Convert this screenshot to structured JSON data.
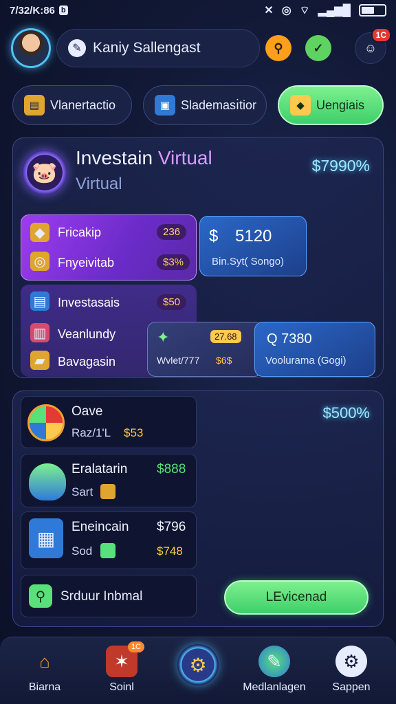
{
  "status": {
    "time": "7/32/K:86",
    "badge": "b",
    "icons": [
      "mute-icon",
      "hotspot-icon",
      "wifi-icon",
      "signal-icon",
      "battery-icon"
    ],
    "battery_level": 0.55
  },
  "header": {
    "user_name": "Kaniy Sallengast",
    "notification_count": "1C"
  },
  "tabs": [
    {
      "label": "Vlanertactio"
    },
    {
      "label": "Slademası̇tior"
    },
    {
      "label": "Uengiais"
    }
  ],
  "investment": {
    "title_part1": "Investain",
    "title_part2": "Virtual",
    "subtitle": "Virtual",
    "price": "$7990%",
    "purple_rows": [
      {
        "label": "Fricakip",
        "value": "236"
      },
      {
        "label": "Fnyeivitab",
        "value": "$3%"
      }
    ],
    "blue_card": {
      "value": "5120",
      "caption": "Bin.Syt( Songo)"
    },
    "list_rows": [
      {
        "label": "Investasais",
        "value": "$50"
      },
      {
        "label": "Veanlundy"
      },
      {
        "label": "Bavagasin"
      }
    ],
    "chip_card": {
      "badge": "27.68",
      "caption": "Wvlet/777",
      "value": "$6$"
    },
    "blue_card2": {
      "value": "Q 7380",
      "caption": "Voolurama (Gogi)"
    }
  },
  "summary": {
    "price": "$500%",
    "items": [
      {
        "title": "Oave",
        "sub": "Raz/1'L",
        "sub_value": "$53"
      },
      {
        "title": "Eralatarin",
        "title_value": "$888",
        "sub": "Sart"
      },
      {
        "title": "Eneincain",
        "title_value": "$796",
        "sub": "Sod",
        "sub_value": "$748"
      }
    ],
    "search_label": "Srduur Inbmal",
    "action_button": "LEvicenad"
  },
  "nav": [
    {
      "label": "Biarna"
    },
    {
      "label": "Soinl",
      "badge": "1C"
    },
    {
      "label": ""
    },
    {
      "label": "Medlanlagen"
    },
    {
      "label": "Sappen"
    }
  ]
}
